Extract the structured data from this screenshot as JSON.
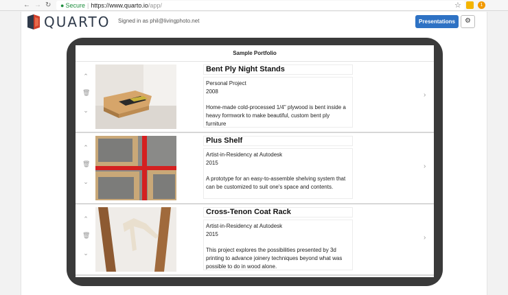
{
  "browser": {
    "secure_label": "Secure",
    "url_host": "https://www.quarto.io",
    "url_path": "/app/",
    "ext_badge": "1"
  },
  "header": {
    "logo_text": "QUARTO",
    "signed_in": "Signed in as phil@livingphoto.net",
    "presentations_label": "Presentations"
  },
  "portfolio": {
    "title": "Sample Portfolio",
    "items": [
      {
        "title": "Bent Ply Night Stands",
        "subtitle": "Personal Project",
        "year": "2008",
        "description": "Home-made cold-processed 1/4\" plywood is bent inside a heavy formwork to make beautiful, custom bent ply furniture"
      },
      {
        "title": "Plus Shelf",
        "subtitle": "Artist-in-Residency at Autodesk",
        "year": "2015",
        "description": "A prototype for an easy-to-assemble shelving system that can be customized to suit one's space and contents."
      },
      {
        "title": "Cross-Tenon Coat Rack",
        "subtitle": "Artist-in-Residency at Autodesk",
        "year": "2015",
        "description": "This project explores the possibilities presented by 3d printing to advance joinery techniques beyond what was possible to do in wood alone."
      }
    ]
  },
  "colors": {
    "accent": "#2e72c4",
    "device_frame": "#3a3a3a",
    "secure_green": "#1e8e3e"
  }
}
